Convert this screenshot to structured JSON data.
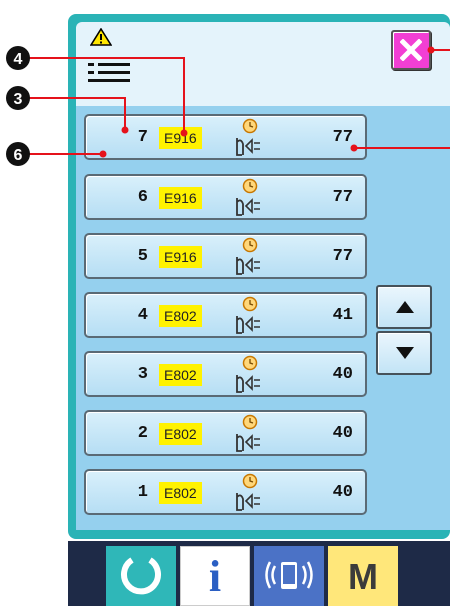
{
  "callouts": {
    "num_error_code": "4",
    "num_number": "3",
    "num_row_button": "6"
  },
  "rows": [
    {
      "number": "7",
      "code": "E916",
      "count": "77"
    },
    {
      "number": "6",
      "code": "E916",
      "count": "77"
    },
    {
      "number": "5",
      "code": "E916",
      "count": "77"
    },
    {
      "number": "4",
      "code": "E802",
      "count": "41"
    },
    {
      "number": "3",
      "code": "E802",
      "count": "40"
    },
    {
      "number": "2",
      "code": "E802",
      "count": "40"
    },
    {
      "number": "1",
      "code": "E802",
      "count": "40"
    }
  ],
  "bottom_bar": {
    "info_label": "i",
    "mode_label": "M"
  },
  "icons": {
    "warning": "warning-triangle-icon",
    "list": "error-list-icon",
    "close": "close-x-icon",
    "tool": "thread-tension-icon",
    "up": "arrow-up-icon",
    "down": "arrow-down-icon",
    "reset": "reset-icon",
    "communication": "communication-icon"
  },
  "colors": {
    "panel_border": "#2ab3b6",
    "close_button": "#f23fd4",
    "code_highlight": "#fff200",
    "callout_line": "#e5121b"
  }
}
